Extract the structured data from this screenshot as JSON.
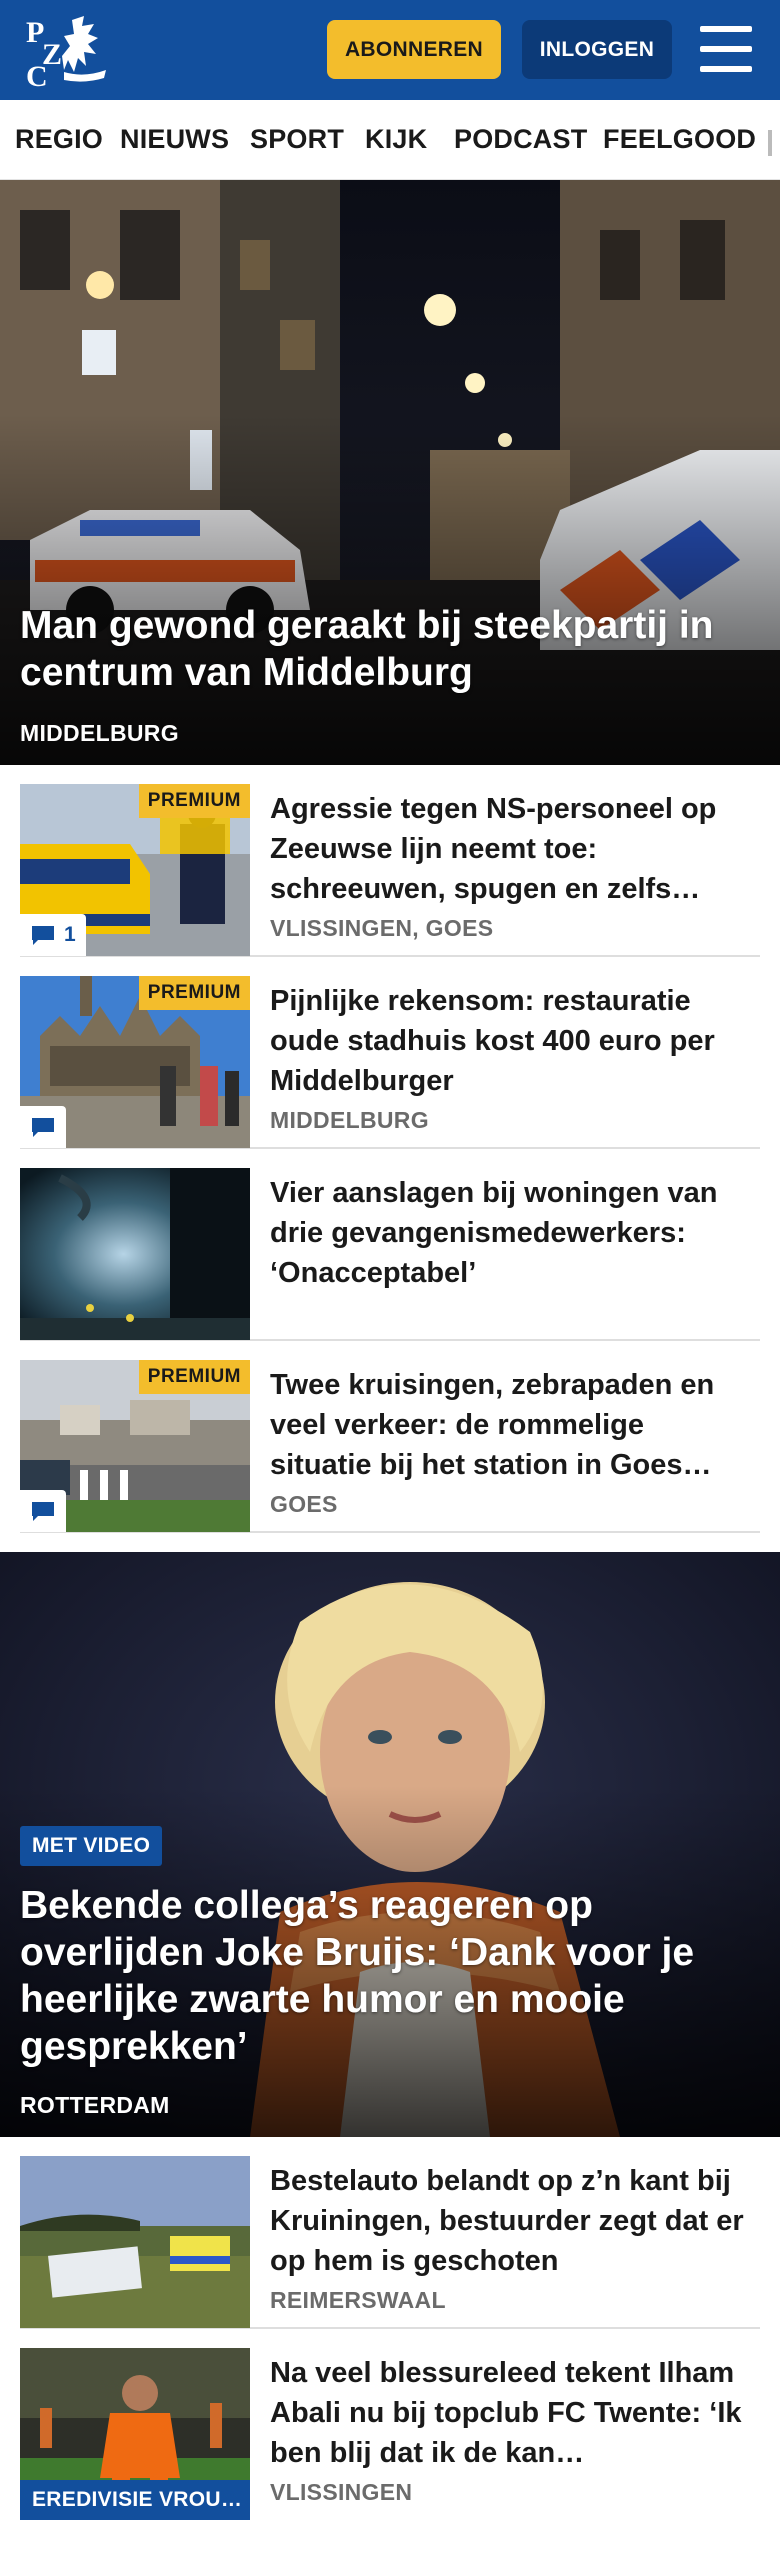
{
  "header": {
    "logo_text": "PZC",
    "subscribe_label": "ABONNEREN",
    "login_label": "INLOGGEN",
    "brand_color": "#124f9d",
    "accent_color": "#f3bd2c"
  },
  "nav": {
    "items": [
      "REGIO",
      "NIEUWS",
      "SPORT",
      "KIJK",
      "PODCAST",
      "FEELGOOD"
    ]
  },
  "hero1": {
    "title": "Man gewond geraakt bij steekpartij in centrum van Middelburg",
    "location": "MIDDELBURG"
  },
  "articles1": [
    {
      "title": "Agressie tegen NS-personeel op Zeeuwse lijn neemt toe: schreeuwen, spugen en zelfs…",
      "location": "VLISSINGEN, GOES",
      "premium": "PREMIUM",
      "comments": "1"
    },
    {
      "title": "Pijnlijke rekensom: restauratie oude stadhuis kost 400 euro per Middelburger",
      "location": "MIDDELBURG",
      "premium": "PREMIUM"
    },
    {
      "title": "Vier aanslagen bij woningen van drie gevangenismedewerkers: ‘Onacceptabel’",
      "location": ""
    },
    {
      "title": "Twee kruisingen, zebrapaden en veel verkeer: de rommelige situatie bij het station in Goes…",
      "location": "GOES",
      "premium": "PREMIUM"
    }
  ],
  "hero2": {
    "badge": "MET VIDEO",
    "title": "Bekende collega’s reageren op overlijden Joke Bruijs: ‘Dank voor je heerlijke zwarte humor en mooie gesprekken’",
    "location": "ROTTERDAM"
  },
  "articles2": [
    {
      "title": "Bestelauto belandt op z’n kant bij Kruiningen, bestuurder zegt dat er op hem is geschoten",
      "location": "REIMERSWAAL"
    },
    {
      "title": "Na veel blessureleed tekent Ilham Abali nu bij topclub FC Twente: ‘Ik ben blij dat ik de kan…",
      "location": "VLISSINGEN",
      "label": "EREDIVISIE VROU…"
    }
  ]
}
